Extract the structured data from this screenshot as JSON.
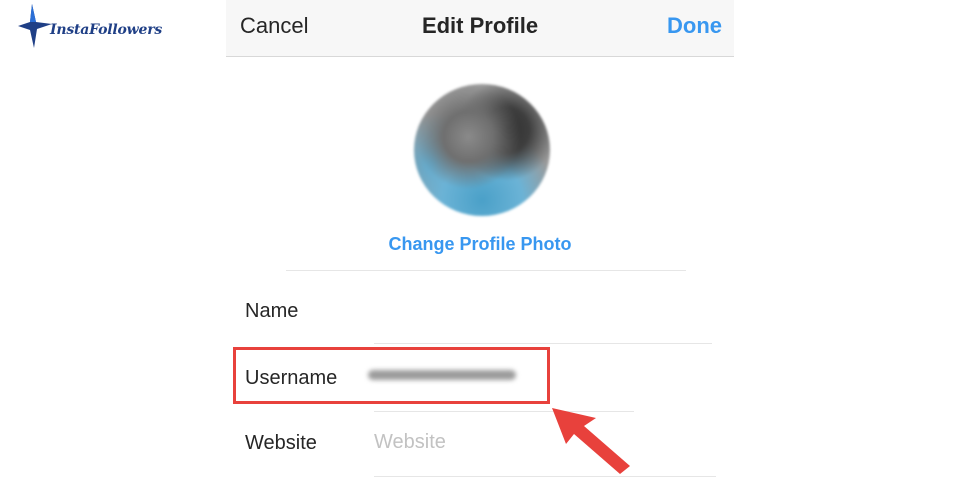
{
  "logo": {
    "text": "InstaFollowers",
    "colors": {
      "primary": "#1f3f86",
      "accent": "#2b6fd6"
    }
  },
  "nav": {
    "cancel": "Cancel",
    "title": "Edit Profile",
    "done": "Done"
  },
  "profile": {
    "change_photo": "Change Profile Photo"
  },
  "fields": {
    "name": {
      "label": "Name",
      "value": ""
    },
    "username": {
      "label": "Username",
      "value": ""
    },
    "website": {
      "label": "Website",
      "placeholder": "Website"
    }
  },
  "annotation": {
    "color": "#e8413c",
    "highlight_target": "username-row",
    "pointer_icon": "arrow-icon"
  },
  "colors": {
    "link": "#3897f0",
    "text": "#262626",
    "placeholder": "#c2c2c2",
    "navbar": "#f7f7f7"
  }
}
